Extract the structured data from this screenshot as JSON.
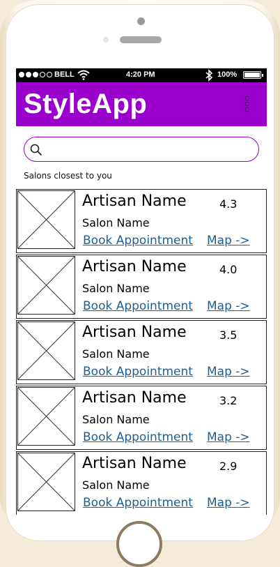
{
  "status_bar": {
    "carrier": "BELL",
    "time": "4:20 PM",
    "battery": "100%",
    "signal_bars_filled": 3,
    "signal_bars_total": 5
  },
  "app": {
    "title": "StyleApp",
    "brand_color": "#9900cc",
    "menu_icon": "vertical-menu-icon"
  },
  "search": {
    "placeholder": "",
    "value": "",
    "icon": "search-icon"
  },
  "section_label": "Salons closest to you",
  "salons": [
    {
      "artisan": "Artisan Name",
      "salon": "Salon Name",
      "rating": "4.3",
      "book": "Book Appointment",
      "map": "Map ->"
    },
    {
      "artisan": "Artisan Name",
      "salon": "Salon Name",
      "rating": "4.0",
      "book": "Book Appointment",
      "map": "Map ->"
    },
    {
      "artisan": "Artisan Name",
      "salon": "Salon Name",
      "rating": "3.5",
      "book": "Book Appointment",
      "map": "Map ->"
    },
    {
      "artisan": "Artisan Name",
      "salon": "Salon Name",
      "rating": "3.2",
      "book": "Book Appointment",
      "map": "Map ->"
    },
    {
      "artisan": "Artisan Name",
      "salon": "Salon Name",
      "rating": "2.9",
      "book": "Book Appointment",
      "map": "Map ->"
    }
  ]
}
